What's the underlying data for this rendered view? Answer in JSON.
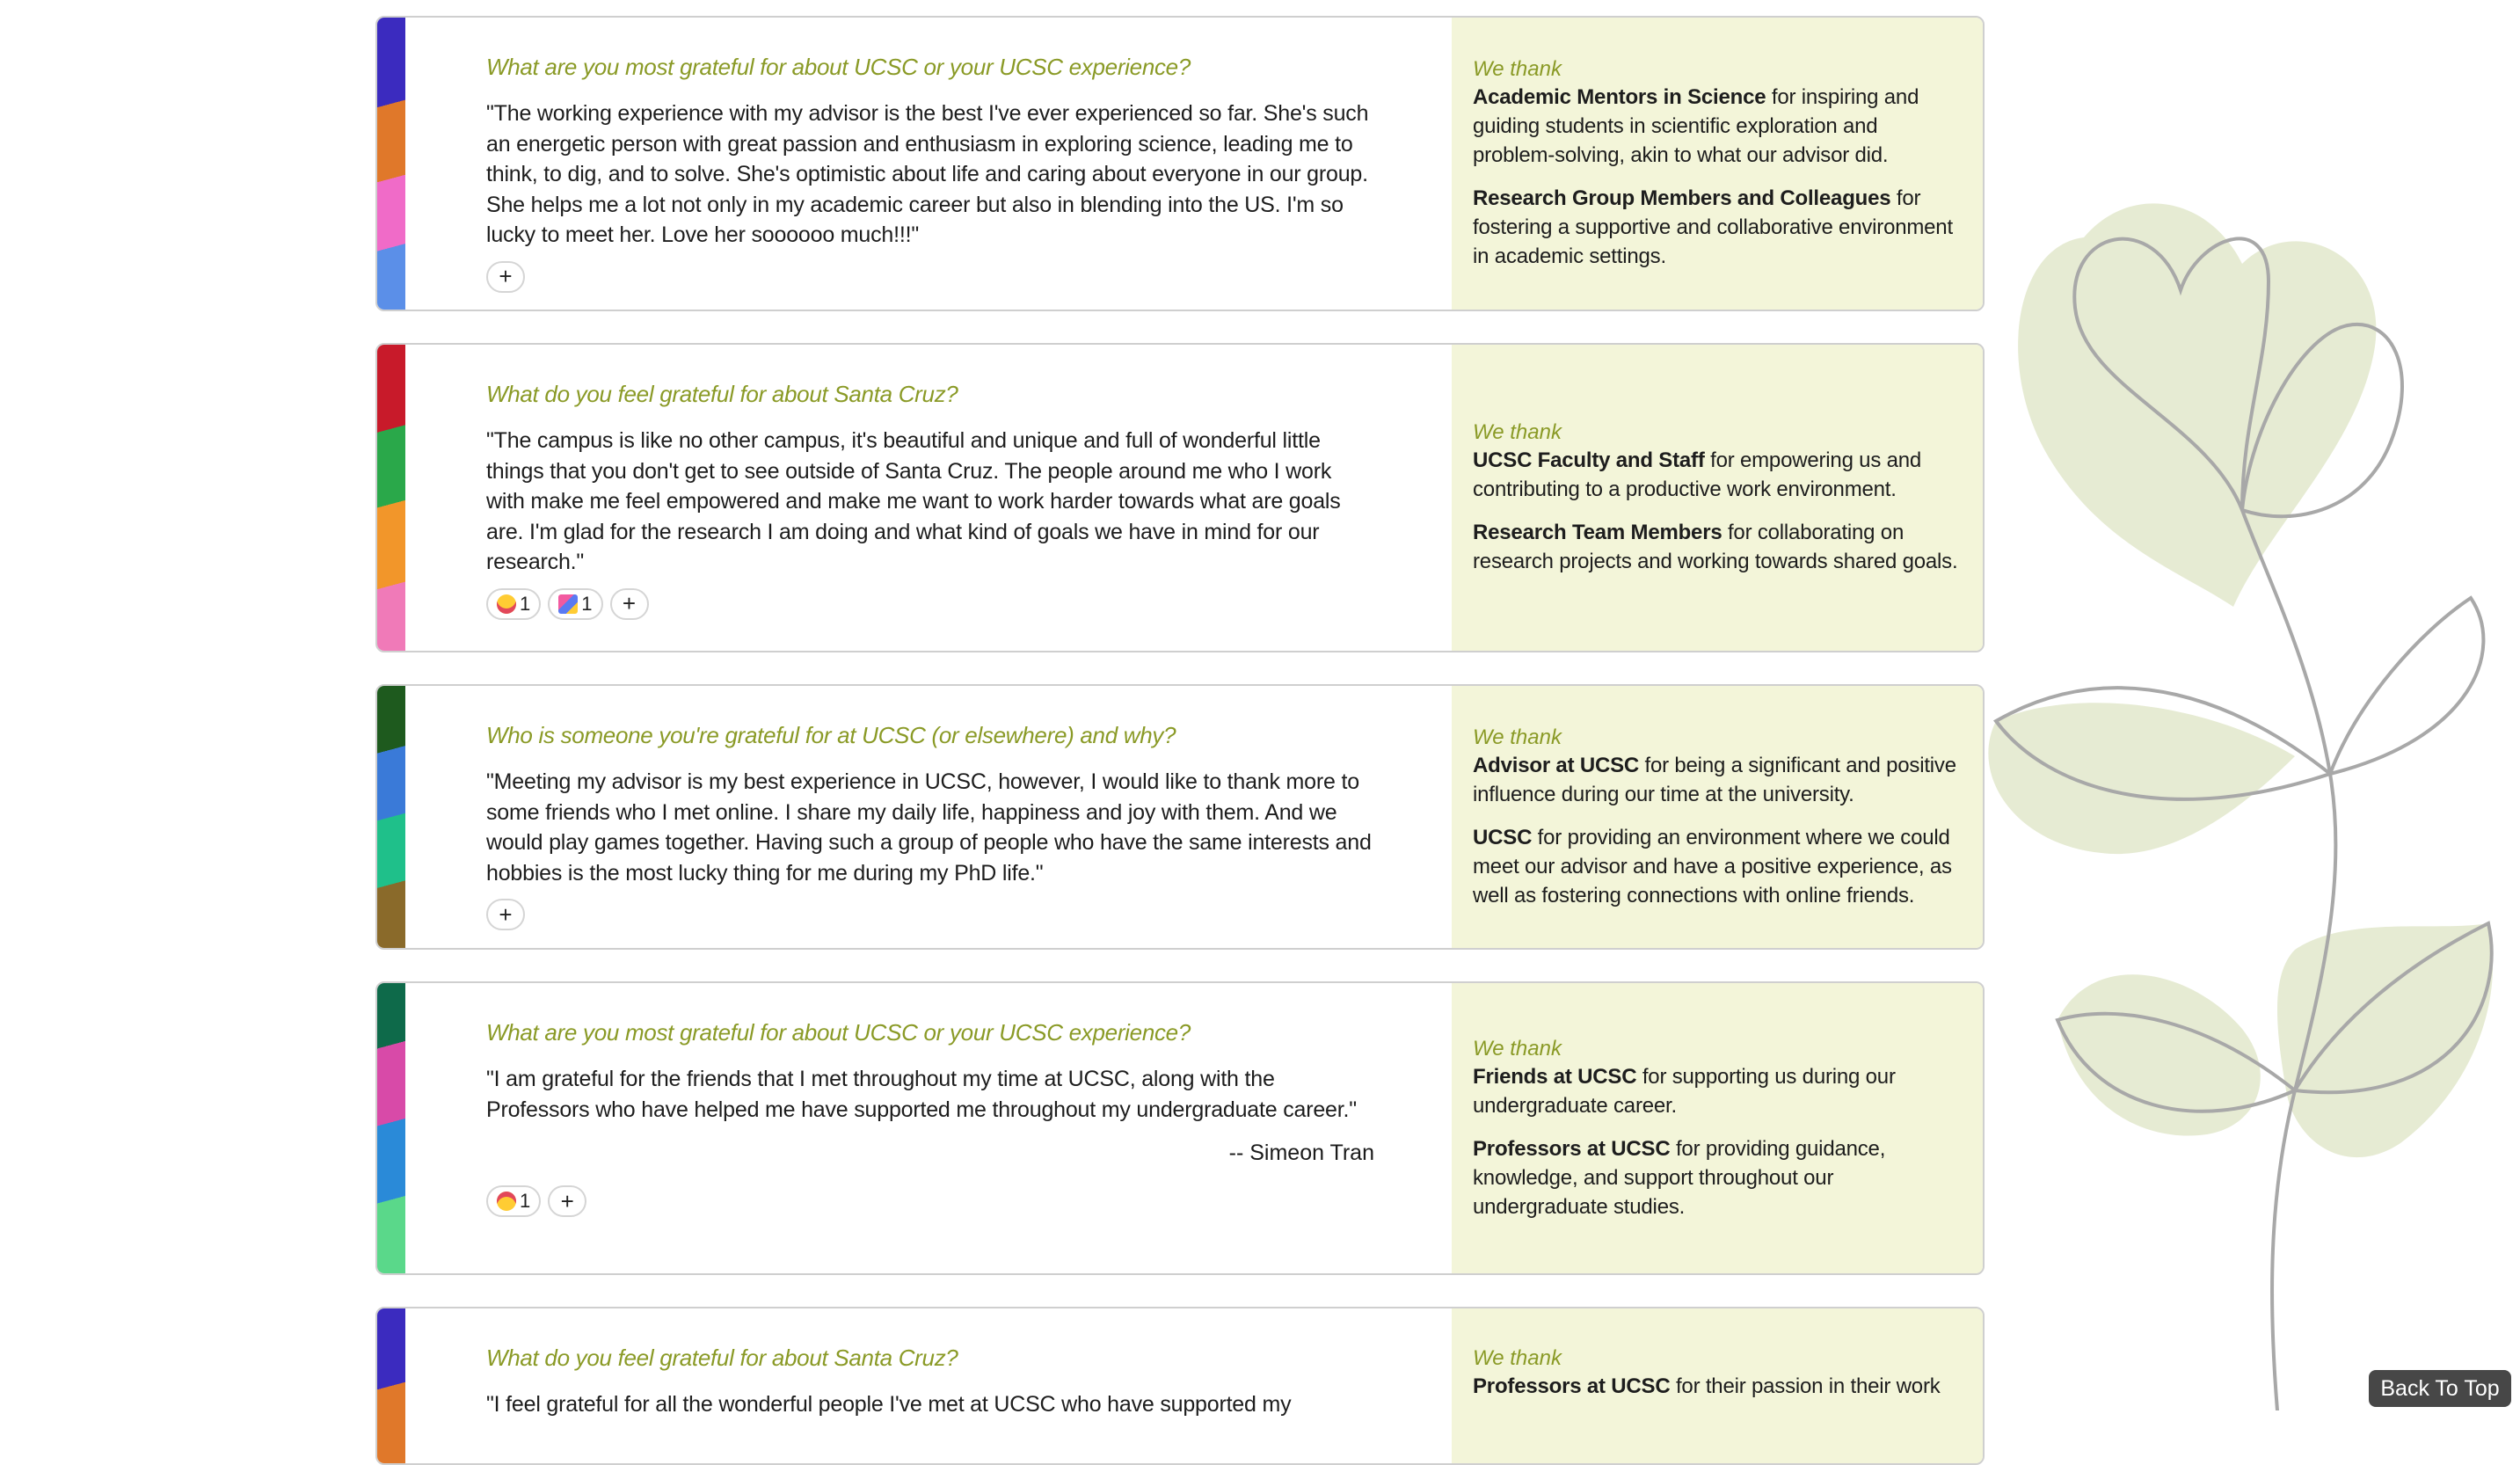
{
  "cards": [
    {
      "question": "What are you most grateful for about UCSC or your UCSC experience?",
      "answer": "\"The working experience with my advisor is the best I've ever experienced so far. She's such an energetic person with great passion and enthusiasm in exploring science, leading me to think, to dig, and to solve. She's optimistic about life and caring about everyone in our group. She helps me a lot not only in my academic career but also in blending into the US. I'm so lucky to meet her. Love her soooooo much!!!\"",
      "author": "",
      "reactions": [],
      "we_thank": "We thank",
      "thanks": [
        {
          "name": "Academic Mentors in Science",
          "text": " for inspiring and guiding students in scientific exploration and problem-solving, akin to what our advisor did."
        },
        {
          "name": "Research Group Members and Colleagues",
          "text": " for fostering a supportive and collaborative environment in academic settings."
        }
      ],
      "stripe_colors": [
        "#3b2bbf",
        "#e0782a",
        "#f06bc8",
        "#5b8fe8"
      ]
    },
    {
      "question": "What do you feel grateful for about Santa Cruz?",
      "answer": "\"The campus is like no other campus, it's beautiful and unique and full of wonderful little things that you don't get to see outside of Santa Cruz. The people around me who I work with make me feel empowered and make me want to work harder towards what are goals are. I'm glad for the research I am doing and what kind of goals we have in mind for our research.\"",
      "author": "",
      "reactions": [
        {
          "emoji": "astonished",
          "count": "1"
        },
        {
          "emoji": "party-popper",
          "count": "1"
        }
      ],
      "we_thank": "We thank",
      "thanks": [
        {
          "name": "UCSC Faculty and Staff",
          "text": " for empowering us and contributing to a productive work environment."
        },
        {
          "name": "Research Team Members",
          "text": " for collaborating on research projects and working towards shared goals."
        }
      ],
      "stripe_colors": [
        "#c81a2a",
        "#2aa84a",
        "#f2962a",
        "#f07ab8"
      ]
    },
    {
      "question": "Who is someone you're grateful for at UCSC (or elsewhere) and why?",
      "answer": "\"Meeting my advisor is my best experience in UCSC, however, I would like to thank more to some friends who I met online. I share my daily life, happiness and joy with them. And we would play games together. Having such a group of people who have the same interests and hobbies is the most lucky thing for me during my PhD life.\"",
      "author": "",
      "reactions": [],
      "we_thank": "We thank",
      "thanks": [
        {
          "name": "Advisor at UCSC",
          "text": " for being a significant and positive influence during our time at the university."
        },
        {
          "name": "UCSC",
          "text": " for providing an environment where we could meet our advisor and have a positive experience, as well as fostering connections with online friends."
        }
      ],
      "stripe_colors": [
        "#1e5a1e",
        "#3a7ad8",
        "#1fc08a",
        "#8a6a2a"
      ]
    },
    {
      "question": "What are you most grateful for about UCSC or your UCSC experience?",
      "answer": "\"I am grateful for the friends that I met throughout my time at UCSC, along with the Professors who have helped me have supported me throughout my undergraduate career.\"",
      "author": "-- Simeon Tran",
      "reactions": [
        {
          "emoji": "heart-eyes",
          "count": "1"
        }
      ],
      "we_thank": "We thank",
      "thanks": [
        {
          "name": "Friends at UCSC",
          "text": " for supporting us during our undergraduate career."
        },
        {
          "name": "Professors at UCSC",
          "text": " for providing guidance, knowledge, and support throughout our undergraduate studies."
        }
      ],
      "stripe_colors": [
        "#0e6a4a",
        "#d84aa8",
        "#2a8ad8",
        "#5ad88a"
      ]
    },
    {
      "question": "What do you feel grateful for about Santa Cruz?",
      "answer": "\"I feel grateful for all the wonderful people I've met at UCSC who have supported my",
      "author": "",
      "reactions": [],
      "we_thank": "We thank",
      "thanks": [
        {
          "name": "Professors at UCSC",
          "text": " for their passion in their work"
        }
      ],
      "stripe_colors": [
        "#3b2bbf",
        "#e0782a",
        "#f06bc8",
        "#5b8fe8"
      ]
    }
  ],
  "add_reaction_label": "+",
  "back_to_top": "Back To Top",
  "colors": {
    "question": "#8a9a26",
    "thank_panel": "#f3f5d9",
    "button_dark": "#474747"
  }
}
